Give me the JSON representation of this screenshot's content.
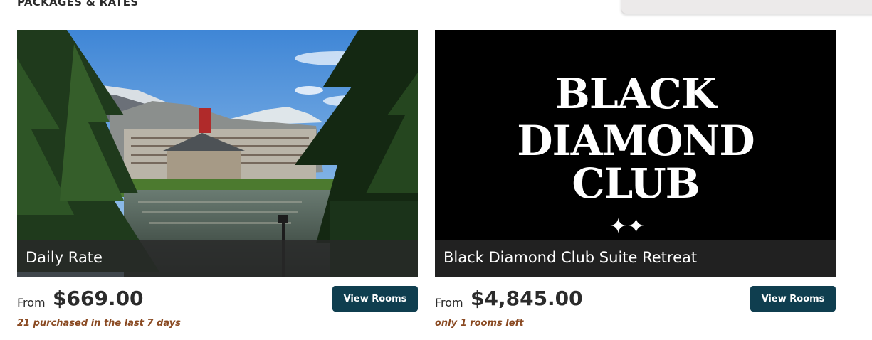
{
  "section": {
    "title": "PACKAGES & RATES"
  },
  "cards": [
    {
      "name": "Daily Rate",
      "image": "mountain-resort-lake-photo",
      "from_label": "From",
      "price": "$669.00",
      "button_label": "View Rooms",
      "urgency": "21 purchased in the last 7 days"
    },
    {
      "name": "Black Diamond Club Suite Retreat",
      "image": "black-diamond-club-logo",
      "logo_lines": [
        "BLACK",
        "DIAMOND",
        "CLUB"
      ],
      "logo_mark": "✦✦",
      "from_label": "From",
      "price": "$4,845.00",
      "button_label": "View Rooms",
      "urgency": "only 1 rooms left"
    }
  ],
  "colors": {
    "button_bg": "#0f3e4f",
    "urgency_text": "#8a4a22",
    "caption_bg": "#282828"
  }
}
